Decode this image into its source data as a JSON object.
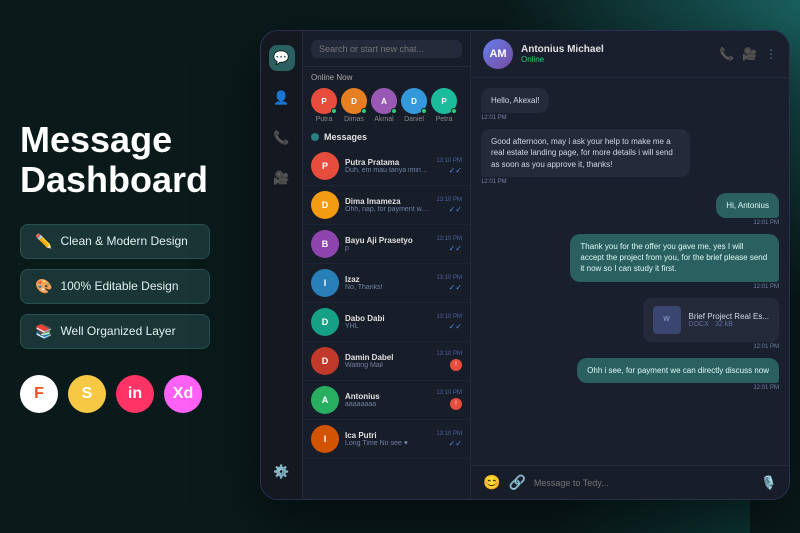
{
  "left": {
    "title_line1": "Message",
    "title_line2": "Dashboard",
    "features": [
      {
        "icon": "✏️",
        "label": "Clean & Modern  Design"
      },
      {
        "icon": "🎨",
        "label": "100% Editable Design"
      },
      {
        "icon": "📚",
        "label": "Well Organized Layer"
      }
    ],
    "tools": [
      {
        "name": "figma",
        "label": "F"
      },
      {
        "name": "sketch",
        "label": "S"
      },
      {
        "name": "invision",
        "label": "in"
      },
      {
        "name": "xd",
        "label": "Xd"
      }
    ]
  },
  "dashboard": {
    "search_placeholder": "Search or start new chat...",
    "online_label": "Online Now",
    "online_users": [
      {
        "name": "Putra",
        "color": "#e74c3c",
        "initial": "P"
      },
      {
        "name": "Dimas",
        "color": "#e67e22",
        "initial": "D"
      },
      {
        "name": "Akmal",
        "color": "#9b59b6",
        "initial": "A"
      },
      {
        "name": "Daniel",
        "color": "#3498db",
        "initial": "D"
      },
      {
        "name": "Petra",
        "color": "#1abc9c",
        "initial": "P"
      }
    ],
    "messages_header": "Messages",
    "chats": [
      {
        "name": "Putra Pratama",
        "preview": "Duh, em mau tanya iming...",
        "time": "13:10 PM",
        "color": "#e74c3c",
        "initial": "P",
        "unread": ""
      },
      {
        "name": "Dima Imameza",
        "preview": "Ohh, nap, for payment we can directly...",
        "time": "13:10 PM",
        "color": "#f39c12",
        "initial": "D",
        "unread": ""
      },
      {
        "name": "Bayu Aji Prasetyo",
        "preview": "p",
        "time": "13:10 PM",
        "color": "#8e44ad",
        "initial": "B",
        "unread": ""
      },
      {
        "name": "Izaz",
        "preview": "No, Thanks!",
        "time": "13:10 PM",
        "color": "#2980b9",
        "initial": "I",
        "unread": ""
      },
      {
        "name": "Dabo Dabi",
        "preview": "YHL",
        "time": "13:10 PM",
        "color": "#16a085",
        "initial": "D",
        "unread": ""
      },
      {
        "name": "Damin Dabel",
        "preview": "Waiting Mail",
        "time": "13:10 PM",
        "color": "#c0392b",
        "initial": "D",
        "badge": "!"
      },
      {
        "name": "Antonius",
        "preview": "aaaaaaaa",
        "time": "13:10 PM",
        "color": "#27ae60",
        "initial": "A",
        "badge": "!"
      },
      {
        "name": "Ica Putri",
        "preview": "Long Time No see ♥",
        "time": "13:10 PM",
        "color": "#d35400",
        "initial": "I",
        "unread": ""
      }
    ],
    "chat_header": {
      "name": "Antonius Michael",
      "status": "Online",
      "initial": "AM"
    },
    "messages": [
      {
        "type": "incoming",
        "text": "Hello, Akexal!",
        "time": "12:01 PM"
      },
      {
        "type": "incoming",
        "text": "Good afternoon, may i ask your help to make me a real estate landing page, for more details i will send as soon as you approve it, thanks!",
        "time": "12:01 PM"
      },
      {
        "type": "outgoing",
        "text": "Hi, Antonius",
        "time": "12:01 PM"
      },
      {
        "type": "outgoing",
        "text": "Thank you for the offer you gave me, yes I will accept the project from you, for the brief please send it now so I can study it first.",
        "time": "12:01 PM"
      },
      {
        "type": "file",
        "name": "Brief Project Real Es...",
        "ext": "DOCX",
        "size": "32 kB",
        "time": "12:01 PM"
      },
      {
        "type": "outgoing",
        "text": "Ohh i see, for payment we can directly discuss now",
        "time": "12:01 PM"
      }
    ],
    "input_placeholder": "Message to Tedy..."
  }
}
